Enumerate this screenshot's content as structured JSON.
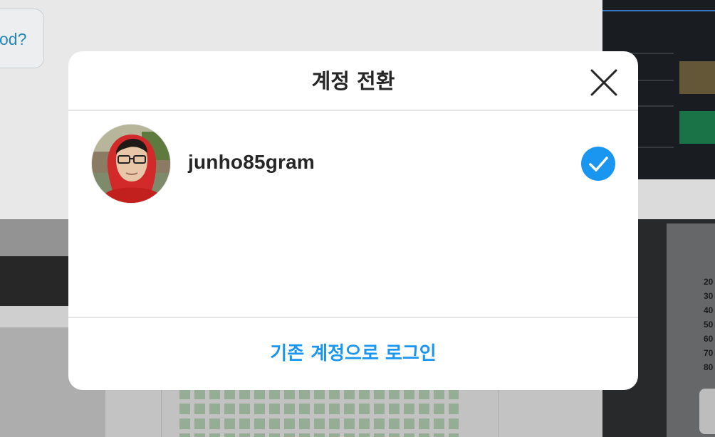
{
  "background": {
    "bubble_text": "od?",
    "scale_numbers": [
      "20",
      "30",
      "40",
      "50",
      "60",
      "70",
      "80"
    ]
  },
  "modal": {
    "title": "계정 전환",
    "close_icon": "close-icon",
    "accounts": [
      {
        "username": "junho85gram",
        "selected": true,
        "avatar": "profile-photo",
        "status_icon": "checkmark-icon"
      }
    ],
    "footer_link": "기존 계정으로 로그인"
  },
  "colors": {
    "accent": "#1a96f0",
    "text": "#262626",
    "divider": "#e3e3e3"
  }
}
